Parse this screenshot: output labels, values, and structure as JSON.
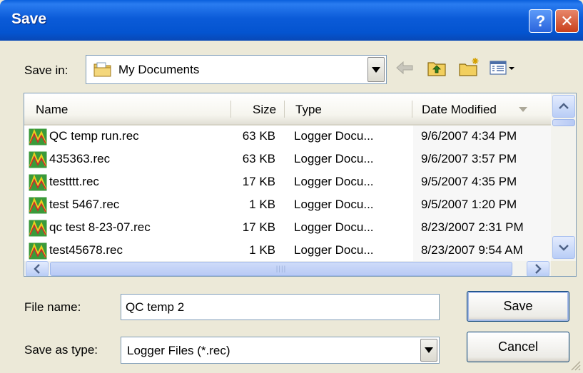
{
  "window": {
    "title": "Save",
    "help_label": "?",
    "close_label": "✕"
  },
  "savein": {
    "label": "Save in:",
    "value": "My Documents",
    "toolbar_icons": [
      "back-arrow-icon",
      "up-one-level-icon",
      "new-folder-icon",
      "views-menu-icon"
    ]
  },
  "list": {
    "columns": [
      "Name",
      "Size",
      "Type",
      "Date Modified"
    ],
    "rows": [
      {
        "name": "QC temp run.rec",
        "size": "63 KB",
        "type": "Logger Docu...",
        "date": "9/6/2007 4:34 PM"
      },
      {
        "name": "435363.rec",
        "size": "63 KB",
        "type": "Logger Docu...",
        "date": "9/6/2007 3:57 PM"
      },
      {
        "name": "testttt.rec",
        "size": "17 KB",
        "type": "Logger Docu...",
        "date": "9/5/2007 4:35 PM"
      },
      {
        "name": "test 5467.rec",
        "size": "1 KB",
        "type": "Logger Docu...",
        "date": "9/5/2007 1:20 PM"
      },
      {
        "name": "qc test 8-23-07.rec",
        "size": "17 KB",
        "type": "Logger Docu...",
        "date": "8/23/2007 2:31 PM"
      },
      {
        "name": "test45678.rec",
        "size": "1 KB",
        "type": "Logger Docu...",
        "date": "8/23/2007 9:54 AM"
      }
    ]
  },
  "form": {
    "filename_label": "File name:",
    "filename_value": "QC temp 2",
    "savetype_label": "Save as type:",
    "savetype_value": "Logger Files (*.rec)"
  },
  "buttons": {
    "save": "Save",
    "cancel": "Cancel"
  },
  "colors": {
    "titlebar": "#0454d0",
    "dialog_bg": "#ece9d8",
    "border_blue": "#7f9db9"
  }
}
